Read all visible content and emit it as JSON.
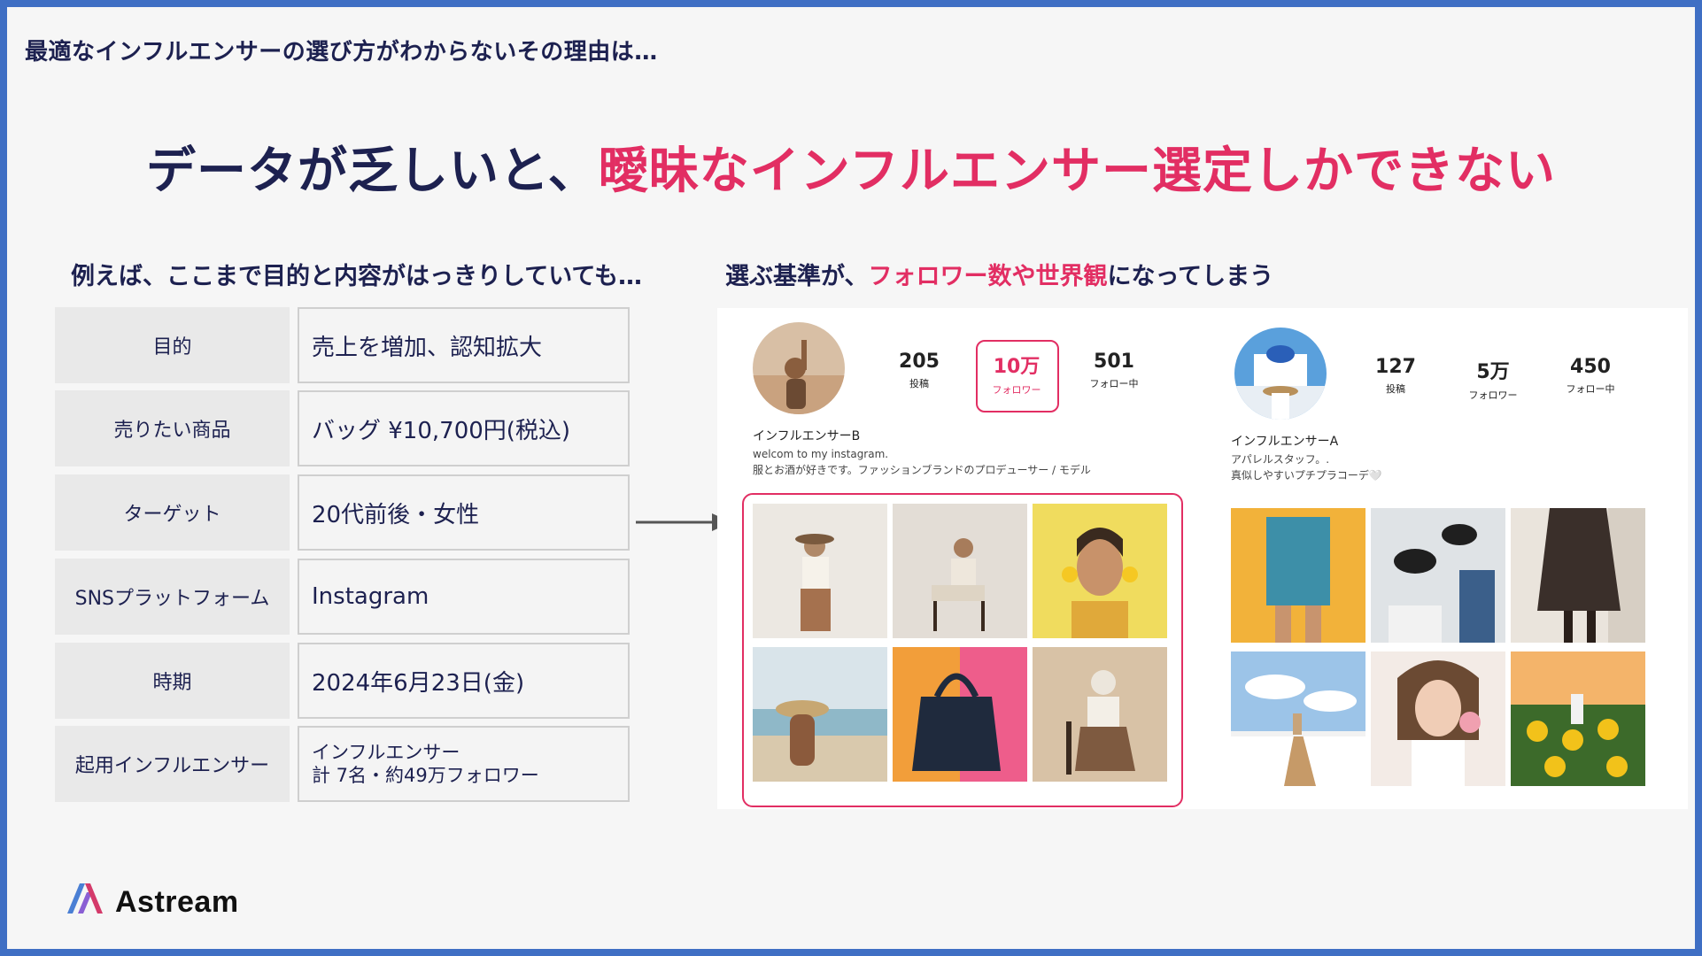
{
  "header": {
    "title": "最適なインフルエンサーの選び方がわからないその理由は…"
  },
  "main_title": {
    "part1": "データが乏しいと、",
    "part2": "曖昧なインフルエンサー選定しかできない"
  },
  "left": {
    "heading": "例えば、ここまで目的と内容がはっきりしていても…",
    "rows": [
      {
        "label": "目的",
        "value": "売上を増加、認知拡大"
      },
      {
        "label": "売りたい商品",
        "value": "バッグ ¥10,700円(税込)"
      },
      {
        "label": "ターゲット",
        "value": "20代前後・女性"
      },
      {
        "label": "SNSプラットフォーム",
        "value": "Instagram"
      },
      {
        "label": "時期",
        "value": "2024年6月23日(金)"
      },
      {
        "label": "起用インフルエンサー",
        "value_line1": "インフルエンサー",
        "value_line2": "計 7名・約49万フォロワー"
      }
    ]
  },
  "right": {
    "heading_part1": "選ぶ基準が、",
    "heading_part2": "フォロワー数や世界観",
    "heading_part3": "になってしまう"
  },
  "profile_b": {
    "name": "インフルエンサーB",
    "bio_line1": "welcom to my instagram.",
    "bio_line2": "服とお酒が好きです。ファッションブランドのプロデューサー / モデル",
    "posts": "205",
    "posts_label": "投稿",
    "followers": "10万",
    "followers_label": "フォロワー",
    "following": "501",
    "following_label": "フォロー中"
  },
  "profile_a": {
    "name": "インフルエンサーA",
    "bio_line1": "アパレルスタッフ。.",
    "bio_line2": "真似しやすいプチプラコーデ🤍",
    "posts": "127",
    "posts_label": "投稿",
    "followers": "5万",
    "followers_label": "フォロワー",
    "following": "450",
    "following_label": "フォロー中"
  },
  "logo": {
    "text": "Astream"
  },
  "colors": {
    "navy": "#1d2150",
    "accent": "#e22e63",
    "border": "#3f6fc4"
  }
}
